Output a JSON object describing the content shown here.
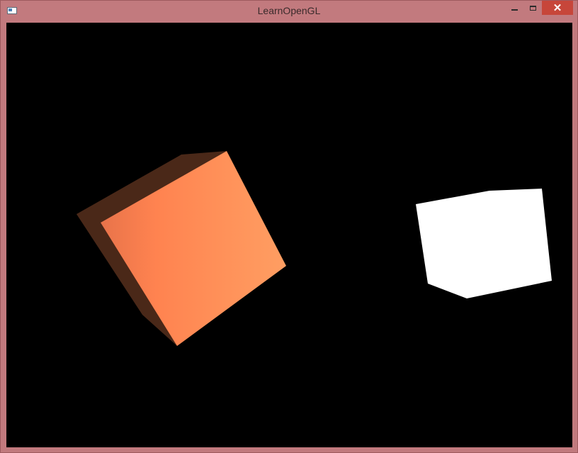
{
  "window": {
    "title": "LearnOpenGL",
    "close_glyph": "✕"
  },
  "icons": {
    "app": "app-window-icon",
    "minimize": "minimize-icon",
    "maximize": "maximize-icon",
    "close": "close-icon"
  },
  "scene": {
    "background_color": "#000000",
    "objects": [
      {
        "name": "lit-cube",
        "color_front": "#ff8a52",
        "color_side": "#4a2818"
      },
      {
        "name": "light-source-cube",
        "color": "#ffffff"
      }
    ]
  }
}
